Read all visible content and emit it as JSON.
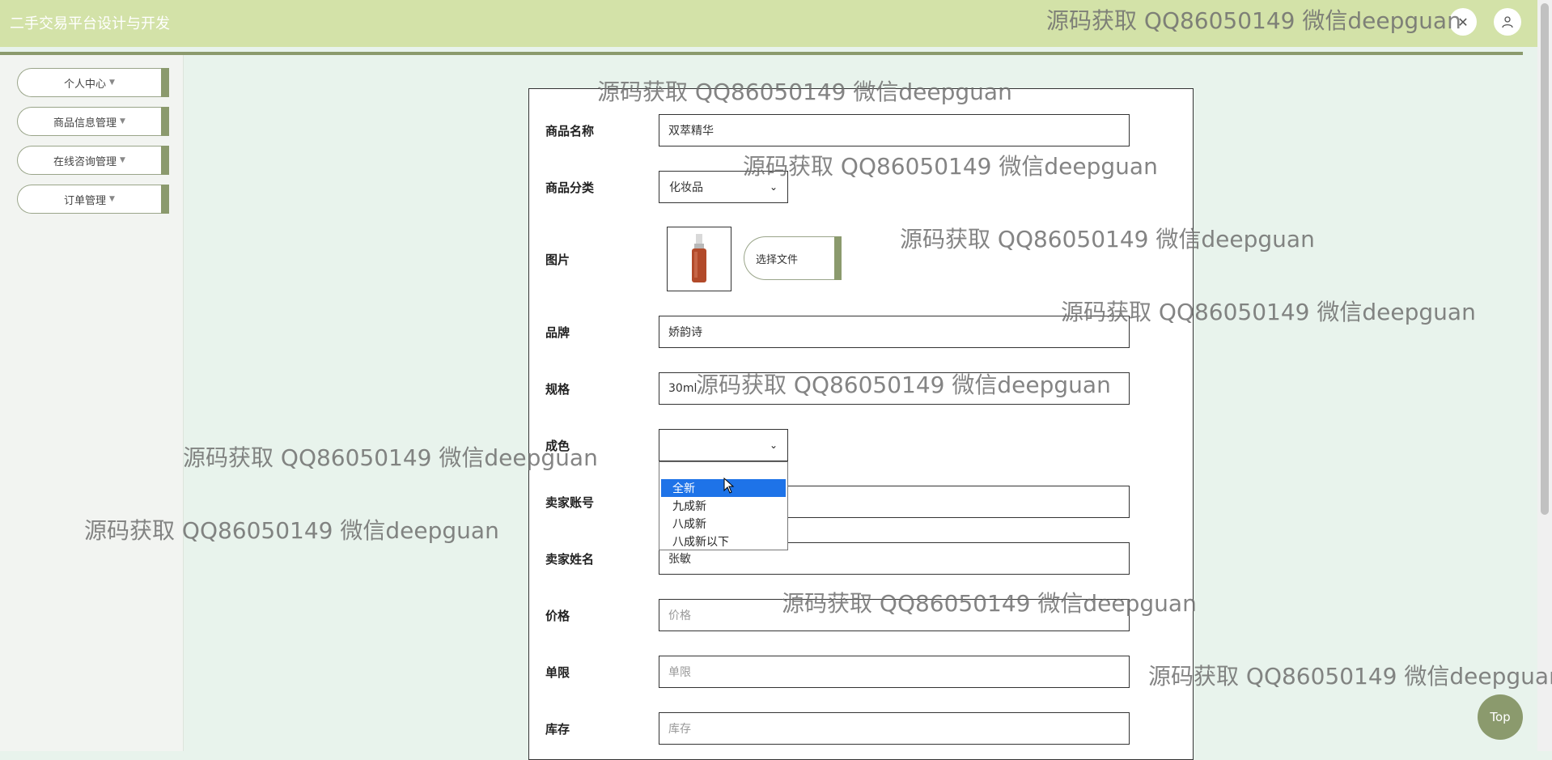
{
  "header": {
    "title": "二手交易平台设计与开发",
    "icons": [
      "close-icon",
      "user-icon"
    ]
  },
  "sidebar": {
    "items": [
      {
        "label": "个人中心"
      },
      {
        "label": "商品信息管理"
      },
      {
        "label": "在线咨询管理"
      },
      {
        "label": "订单管理"
      }
    ]
  },
  "form": {
    "name": {
      "label": "商品名称",
      "value": "双萃精华"
    },
    "category": {
      "label": "商品分类",
      "value": "化妆品"
    },
    "image": {
      "label": "图片",
      "button": "选择文件"
    },
    "brand": {
      "label": "品牌",
      "value": "娇韵诗"
    },
    "spec": {
      "label": "规格",
      "value": "30ml"
    },
    "condition": {
      "label": "成色",
      "value": "",
      "options": [
        "全新",
        "九成新",
        "八成新",
        "八成新以下"
      ],
      "highlighted": "全新"
    },
    "seller_account": {
      "label": "卖家账号",
      "value": ""
    },
    "seller_name": {
      "label": "卖家姓名",
      "value": "张敏"
    },
    "price": {
      "label": "价格",
      "placeholder": "价格"
    },
    "limit": {
      "label": "单限",
      "placeholder": "单限"
    },
    "stock": {
      "label": "库存",
      "placeholder": "库存"
    }
  },
  "top_button": "Top",
  "watermark": "源码获取 QQ86050149 微信deepguan",
  "colors": {
    "header": "#d3e2a8",
    "accent": "#8b9a6d",
    "background": "#e8f3ec",
    "selection": "#1e73e8"
  }
}
